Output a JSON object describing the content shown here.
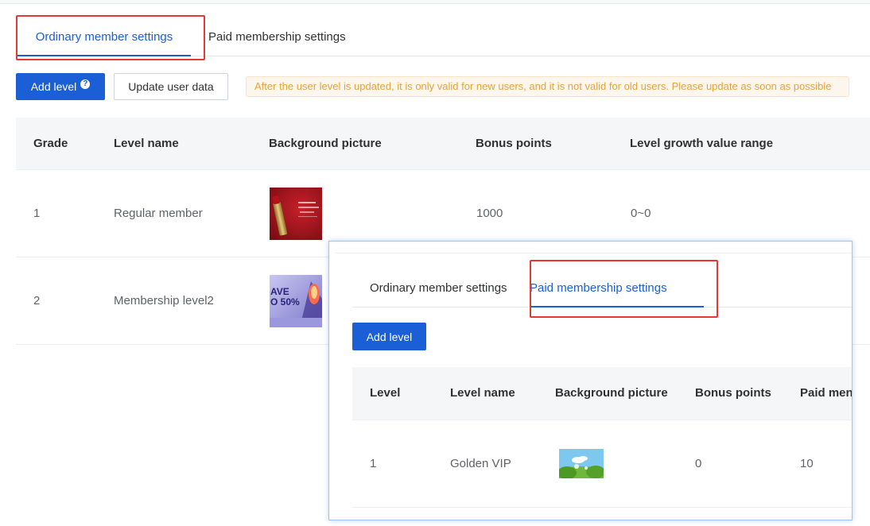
{
  "main": {
    "tabs": [
      {
        "label": "Ordinary member settings",
        "active": true
      },
      {
        "label": "Paid membership settings",
        "active": false
      }
    ],
    "toolbar": {
      "add_level_label": "Add level",
      "help_icon": "?",
      "update_label": "Update user data",
      "notice": "After the user level is updated, it is only valid for new users, and it is not valid for old users. Please update as soon as possible"
    },
    "table": {
      "headers": [
        "Grade",
        "Level name",
        "Background picture",
        "Bonus points",
        "Level growth value range"
      ],
      "rows": [
        {
          "grade": "1",
          "name": "Regular member",
          "picture": "red-lipstick-banner",
          "points": "1000",
          "range": "0~0"
        },
        {
          "grade": "2",
          "name": "Membership level2",
          "picture": "save-50-percent-banner",
          "points": "",
          "range": ""
        }
      ]
    },
    "thumb2_text": "AVE\nO 50%"
  },
  "panel": {
    "tabs": [
      {
        "label": "Ordinary member settings",
        "active": false
      },
      {
        "label": "Paid membership settings",
        "active": true
      }
    ],
    "add_level_label": "Add level",
    "table": {
      "headers": [
        "Level",
        "Level name",
        "Background picture",
        "Bonus points",
        "Paid men"
      ],
      "rows": [
        {
          "level": "1",
          "name": "Golden VIP",
          "picture": "green-landscape-card",
          "points": "0",
          "paid": "10"
        }
      ]
    }
  },
  "colors": {
    "accent": "#1a5fd6",
    "highlight_box": "#e53935",
    "notice_text": "#e6a23c",
    "notice_bg": "#fdf6ec"
  }
}
